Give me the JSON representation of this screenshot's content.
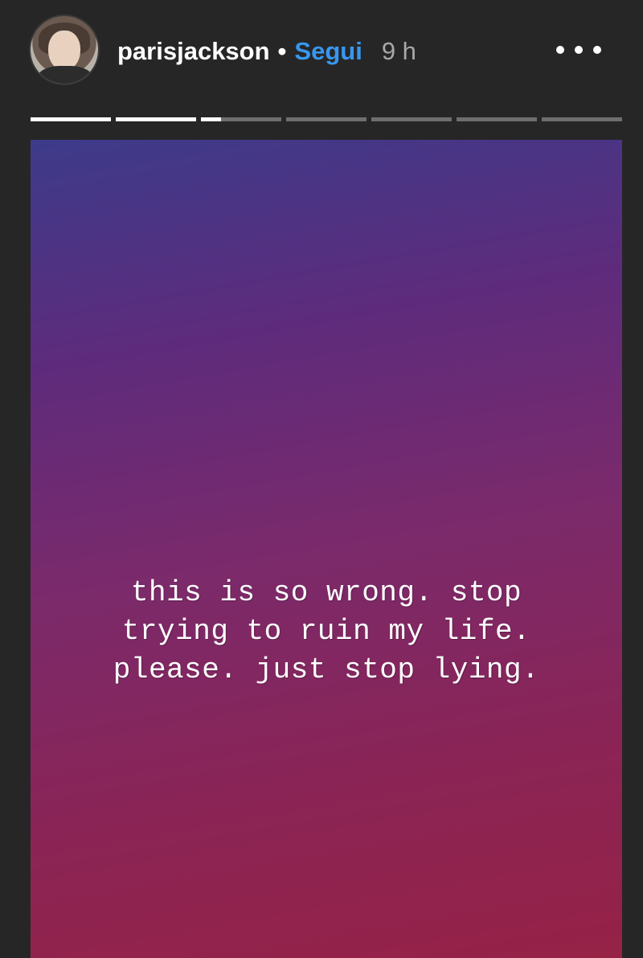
{
  "header": {
    "username": "parisjackson",
    "separator": "•",
    "follow_label": "Segui",
    "time_ago": "9 h",
    "more_icon": "more-horizontal-icon"
  },
  "progress": {
    "segments": [
      1,
      1,
      0.25,
      0,
      0,
      0,
      0
    ]
  },
  "story": {
    "lines": [
      "this is so wrong. stop",
      "trying to ruin my life.",
      "please. just stop lying."
    ],
    "colors": {
      "gradient_top": "#3d3b8a",
      "gradient_bottom": "#962246",
      "follow_accent": "#3897f0"
    }
  }
}
